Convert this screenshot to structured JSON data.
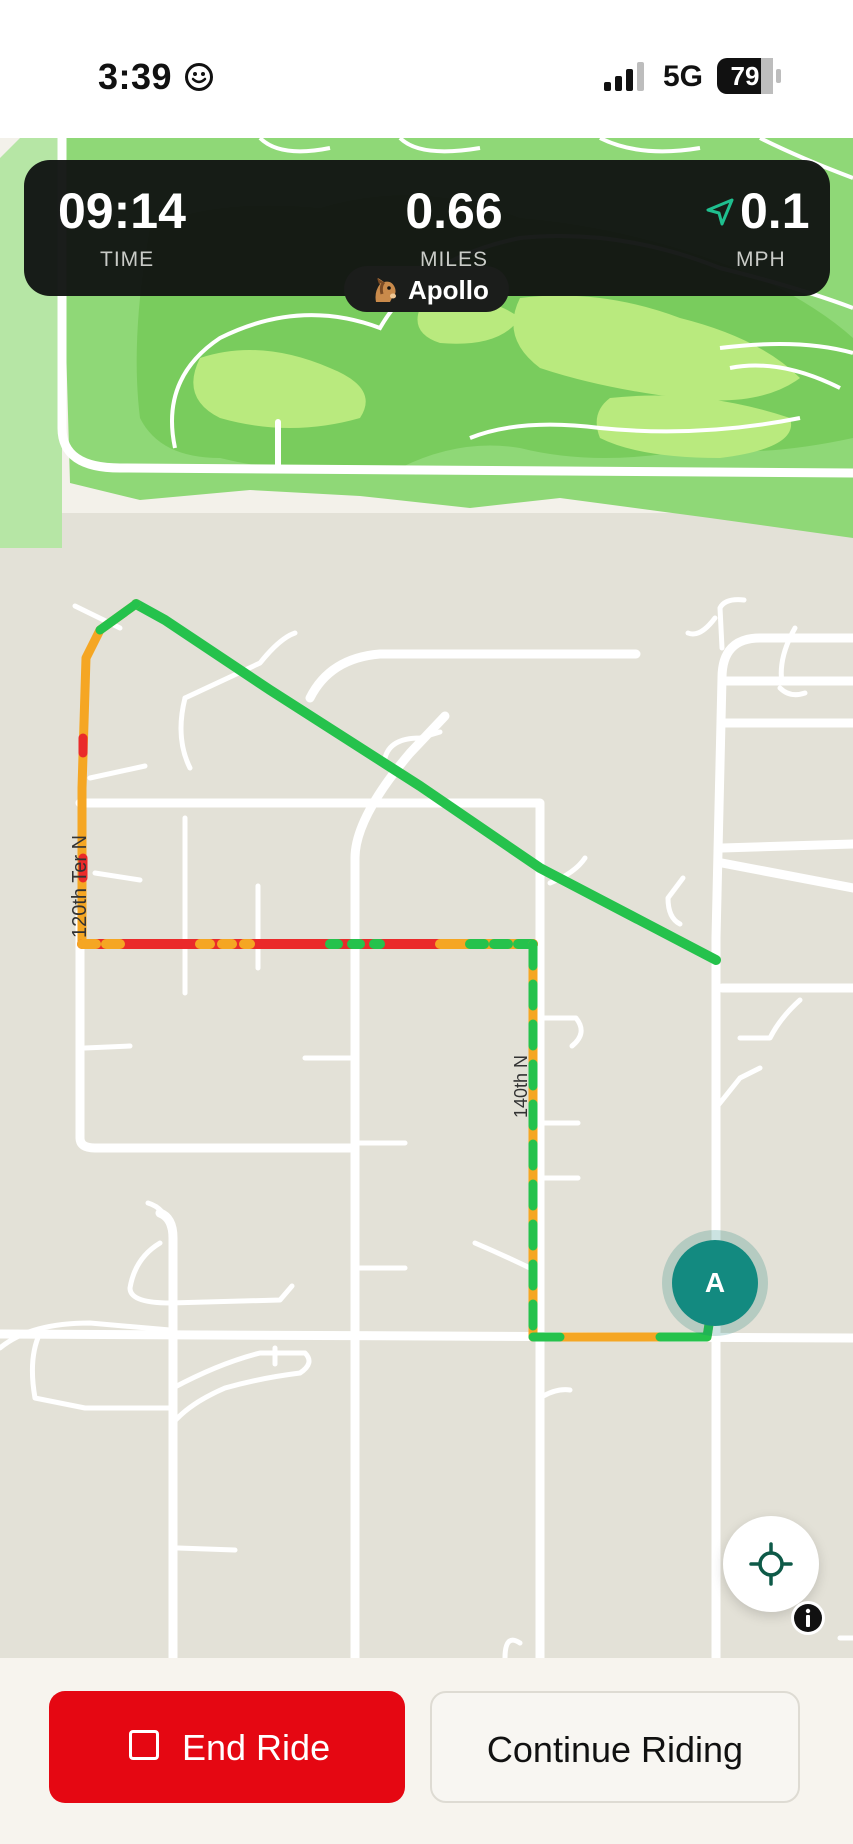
{
  "status_bar": {
    "time": "3:39",
    "network": "5G",
    "battery": "79",
    "icons": [
      "smiley-face-icon",
      "cellular-signal-icon",
      "battery-icon"
    ]
  },
  "stats": {
    "time_value": "09:14",
    "time_label": "TIME",
    "miles_value": "0.66",
    "miles_label": "MILES",
    "speed_value": "0.1",
    "speed_label": "MPH",
    "speed_icon": "navigation-arrow-icon"
  },
  "horse": {
    "emoji": "horse-face-icon",
    "name": "Apollo"
  },
  "map": {
    "street_label_1": "120th Ter N",
    "street_label_2": "140th N",
    "marker_label": "A",
    "colors": {
      "land": "#e3e1d7",
      "road": "#ffffff",
      "park": "#8fd877",
      "track_fast": "#25c24c",
      "track_medium": "#f5a623",
      "track_slow": "#ea2a2a"
    }
  },
  "controls": {
    "locate_icon": "crosshair-icon",
    "info_icon": "info-icon"
  },
  "actions": {
    "end_label": "End Ride",
    "end_icon": "stop-square-icon",
    "continue_label": "Continue Riding",
    "colors": {
      "end": "#e50712"
    }
  }
}
